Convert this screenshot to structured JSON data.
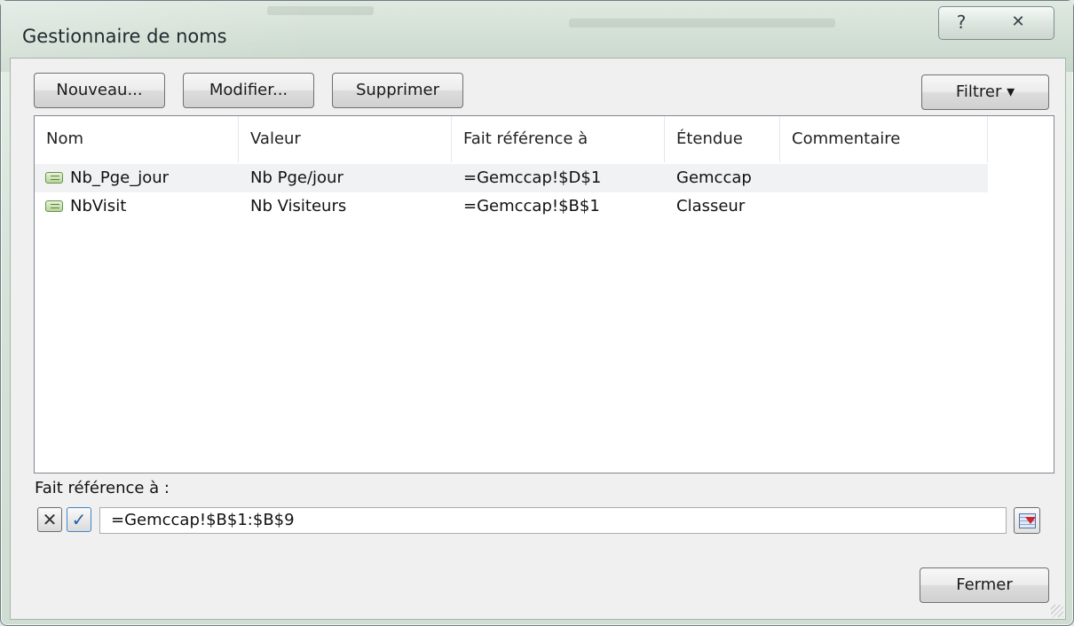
{
  "window": {
    "title": "Gestionnaire de noms",
    "help_glyph": "?",
    "close_glyph": "✕"
  },
  "toolbar": {
    "new_label": "Nouveau...",
    "edit_label": "Modifier...",
    "delete_label": "Supprimer",
    "filter_label": "Filtrer ▾"
  },
  "list": {
    "columns": [
      "Nom",
      "Valeur",
      "Fait référence à",
      "Étendue",
      "Commentaire"
    ],
    "rows": [
      {
        "name": "Nb_Pge_jour",
        "value": "Nb Pge/jour",
        "refers_to": "=Gemccap!$D$1",
        "scope": "Gemccap",
        "comment": "",
        "selected": true
      },
      {
        "name": "NbVisit",
        "value": "Nb Visiteurs",
        "refers_to": "=Gemccap!$B$1",
        "scope": "Classeur",
        "comment": "",
        "selected": false
      }
    ]
  },
  "refers_to": {
    "label": "Fait référence à :",
    "value": "=Gemccap!$B$1:$B$9",
    "cancel_glyph": "✕",
    "ok_glyph": "✓"
  },
  "footer": {
    "close_label": "Fermer"
  },
  "icons": {
    "name_item": "named-range-icon",
    "collapse": "collapse-dialog-icon"
  }
}
